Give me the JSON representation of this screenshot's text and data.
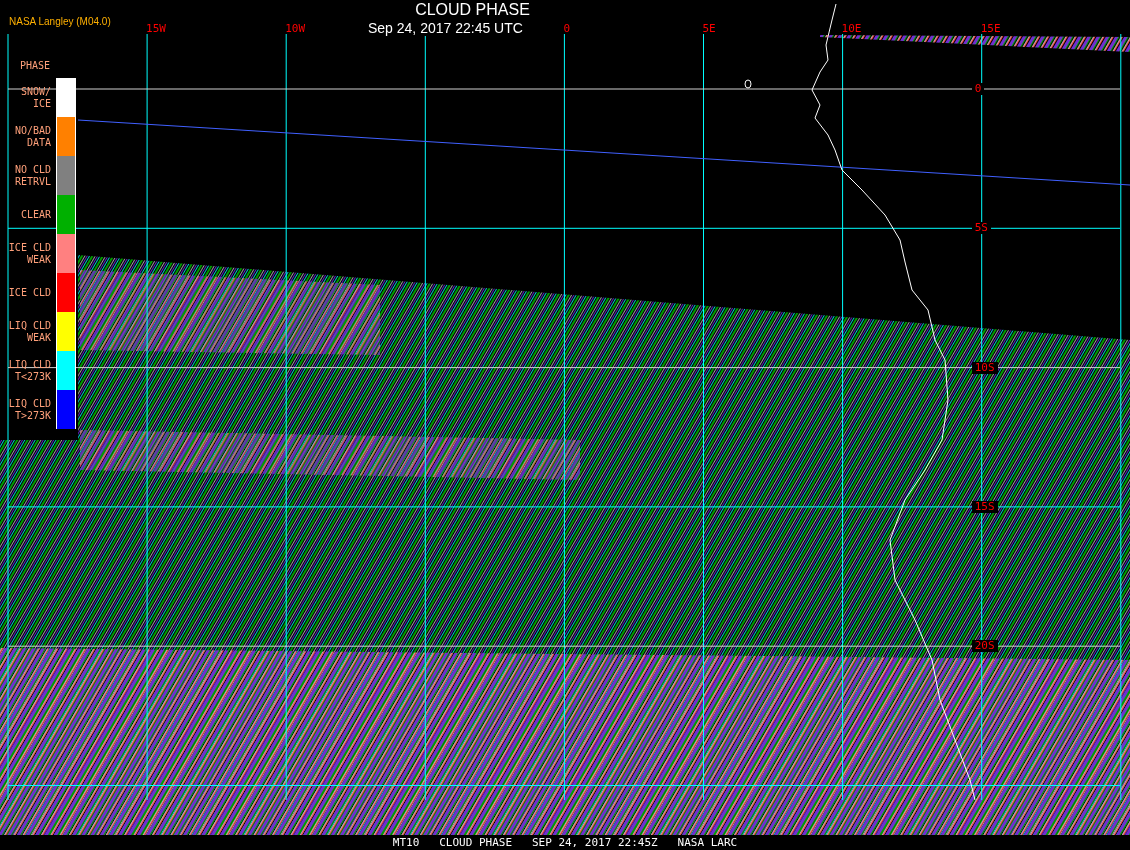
{
  "header": {
    "title": "CLOUD PHASE",
    "timestamp": "Sep 24, 2017 22:45 UTC",
    "source": "NASA Langley (M04.0)"
  },
  "map": {
    "longitude_labels": [
      "15W",
      "10W",
      "0",
      "5E",
      "10E",
      "15E"
    ],
    "latitude_labels": [
      "0",
      "5S",
      "10S",
      "15S",
      "20S"
    ]
  },
  "legend": {
    "title": "PHASE",
    "items": [
      {
        "label": "SNOW/\nICE",
        "color": "#ffffff"
      },
      {
        "label": "NO/BAD\nDATA",
        "color": "#ff8000"
      },
      {
        "label": "NO CLD\nRETRVL",
        "color": "#808080"
      },
      {
        "label": "CLEAR",
        "color": "#00b000"
      },
      {
        "label": "ICE CLD\nWEAK",
        "color": "#ff8080"
      },
      {
        "label": "ICE CLD",
        "color": "#ff0000"
      },
      {
        "label": "LIQ CLD\nWEAK",
        "color": "#ffff00"
      },
      {
        "label": "LIQ CLD\nT<273K",
        "color": "#00ffff"
      },
      {
        "label": "LIQ CLD\nT>273K",
        "color": "#0000ff"
      }
    ]
  },
  "footer": {
    "caption": "MT10   CLOUD PHASE   SEP 24, 2017 22:45Z   NASA LARC"
  }
}
